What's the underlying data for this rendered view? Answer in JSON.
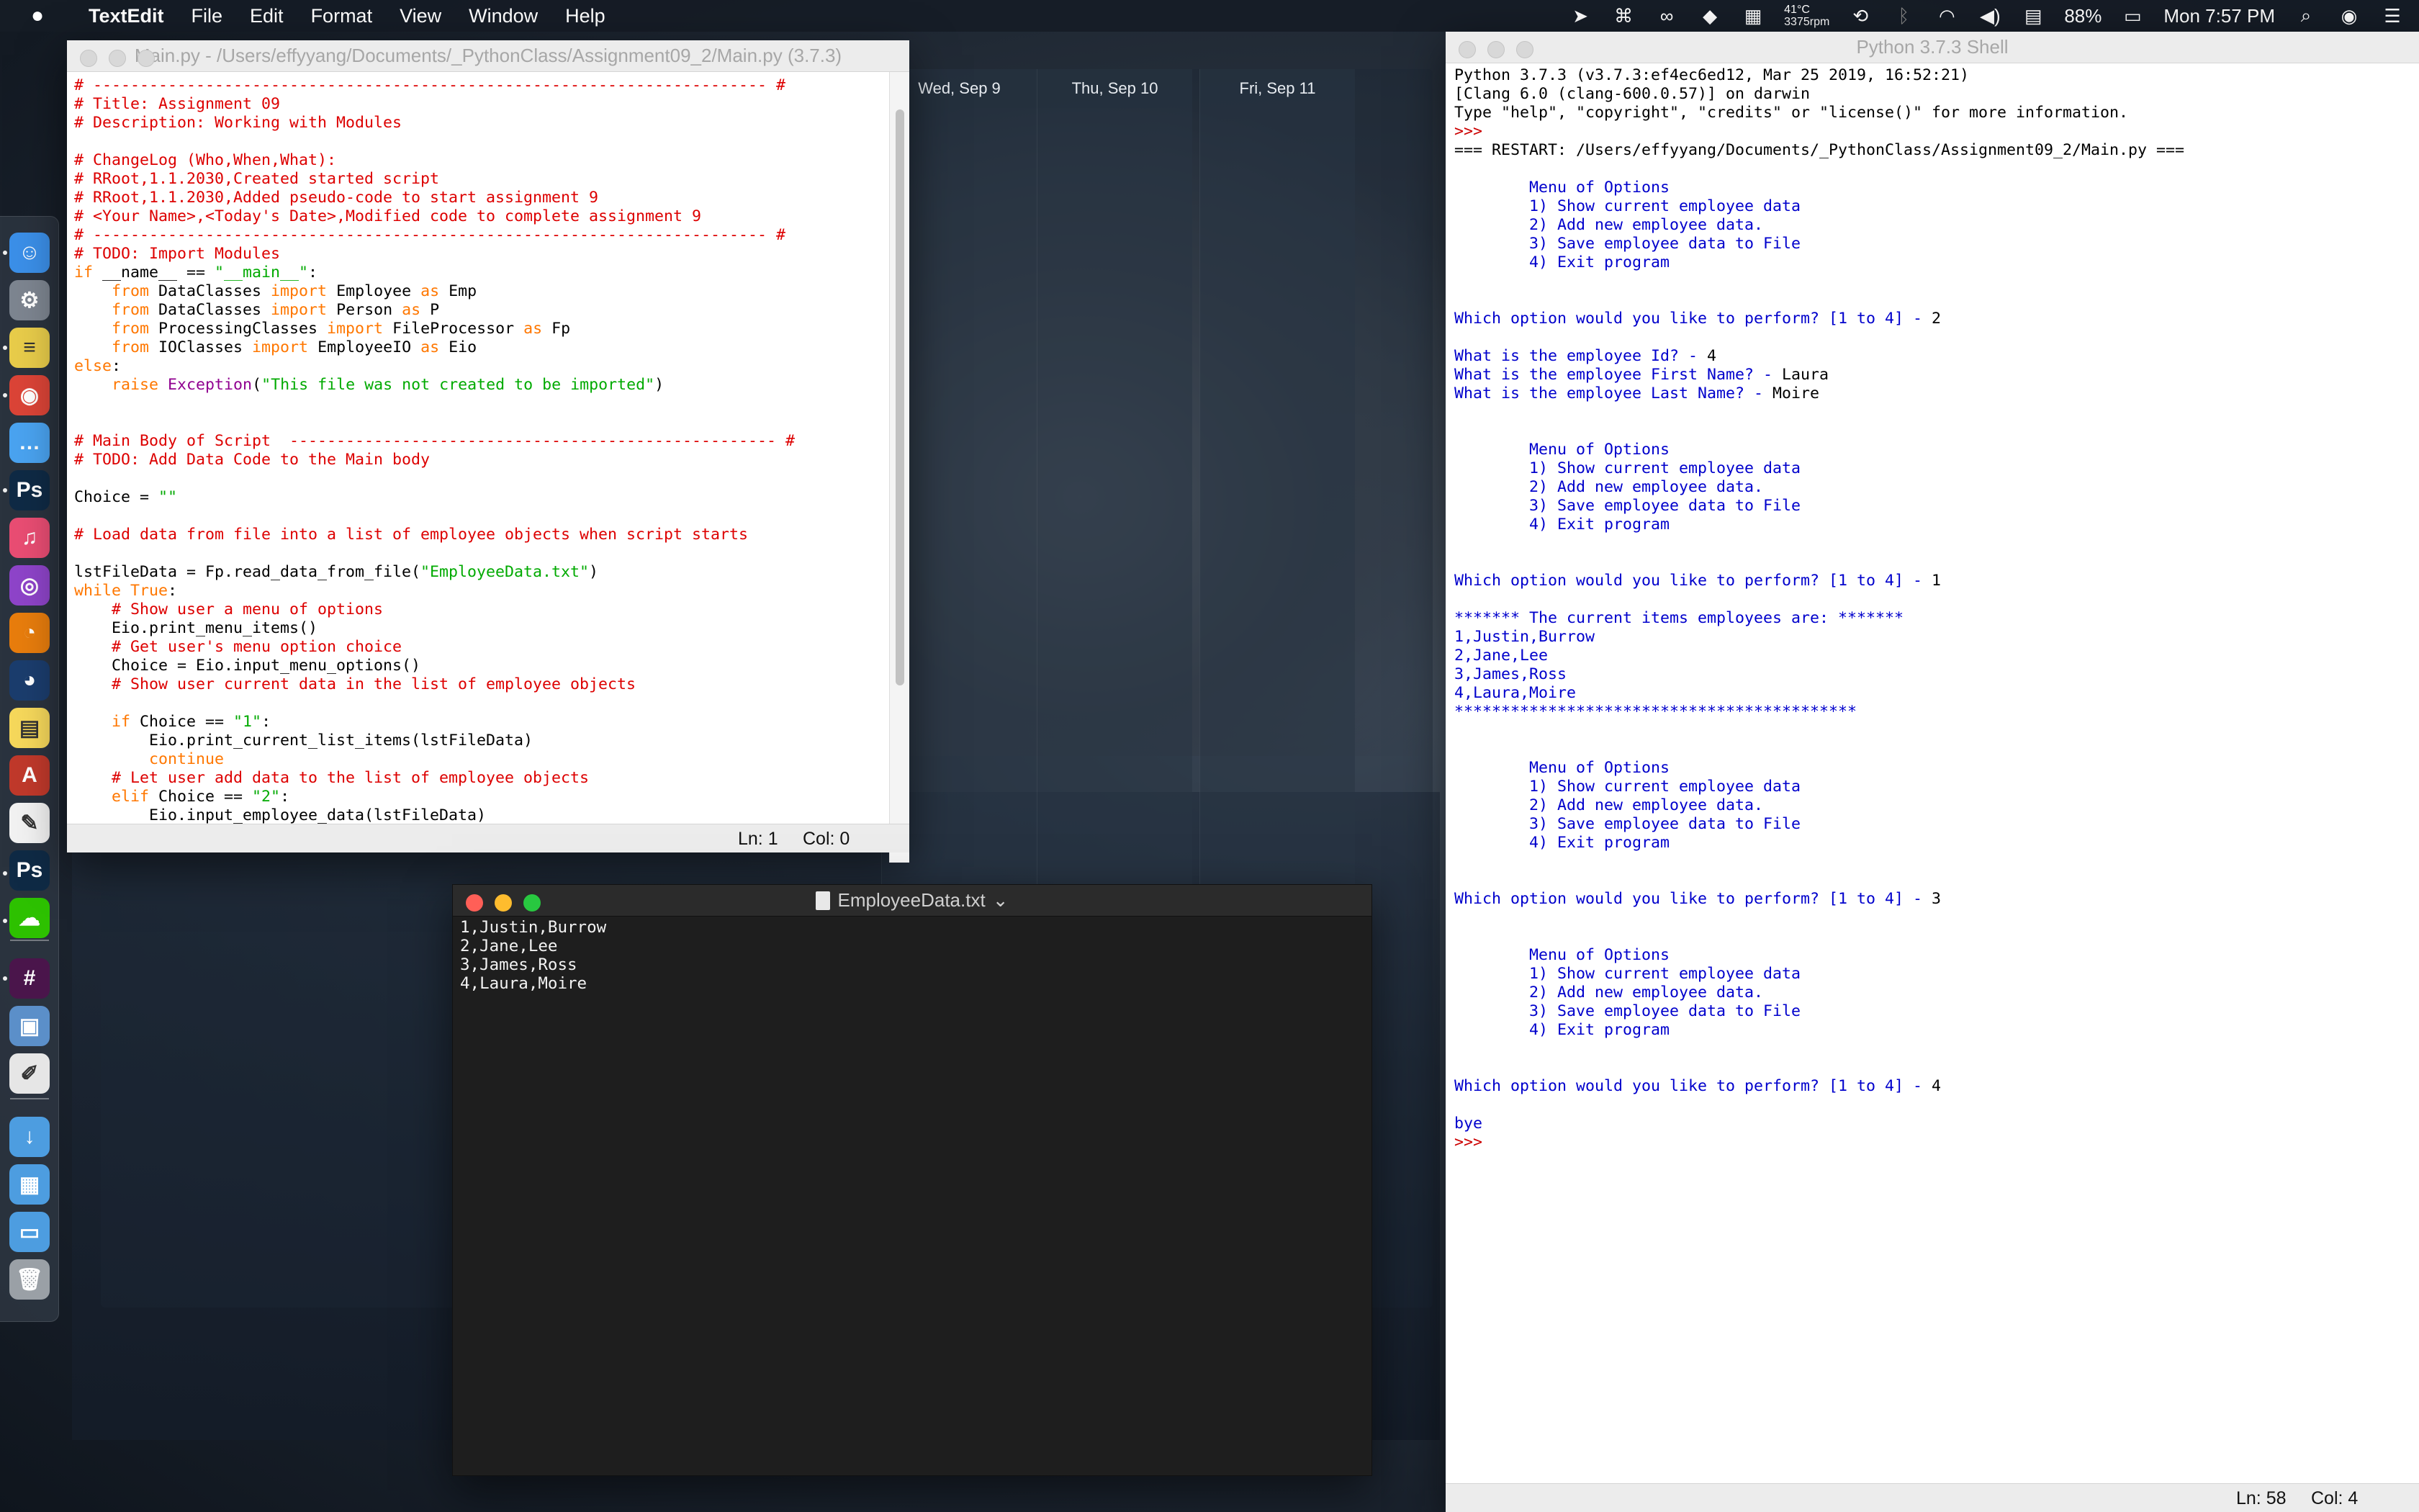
{
  "menubar": {
    "app": "TextEdit",
    "items": [
      "File",
      "Edit",
      "Format",
      "View",
      "Window",
      "Help"
    ],
    "temp_top": "41°C",
    "temp_bottom": "3375rpm",
    "battery": "88%",
    "clock": "Mon 7:57 PM"
  },
  "calendar": {
    "days": [
      "Wed, Sep 9",
      "Thu, Sep 10",
      "Fri, Sep 11"
    ]
  },
  "editor": {
    "title": "Main.py - /Users/effyyang/Documents/_PythonClass/Assignment09_2/Main.py (3.7.3)",
    "status_line": "Ln: 1",
    "status_col": "Col: 0",
    "lines": [
      [
        [
          "cm",
          "# ------------------------------------------------------------------------ #"
        ]
      ],
      [
        [
          "cm",
          "# Title: Assignment 09"
        ]
      ],
      [
        [
          "cm",
          "# Description: Working with Modules"
        ]
      ],
      [
        [
          "df",
          ""
        ]
      ],
      [
        [
          "cm",
          "# ChangeLog (Who,When,What):"
        ]
      ],
      [
        [
          "cm",
          "# RRoot,1.1.2030,Created started script"
        ]
      ],
      [
        [
          "cm",
          "# RRoot,1.1.2030,Added pseudo-code to start assignment 9"
        ]
      ],
      [
        [
          "cm",
          "# <Your Name>,<Today's Date>,Modified code to complete assignment 9"
        ]
      ],
      [
        [
          "cm",
          "# ------------------------------------------------------------------------ #"
        ]
      ],
      [
        [
          "cm",
          "# TODO: Import Modules"
        ]
      ],
      [
        [
          "kw",
          "if"
        ],
        [
          "df",
          " __name__ == "
        ],
        [
          "st",
          "\"__main__\""
        ],
        [
          "df",
          ":"
        ]
      ],
      [
        [
          "df",
          "    "
        ],
        [
          "kw",
          "from"
        ],
        [
          "df",
          " DataClasses "
        ],
        [
          "kw",
          "import"
        ],
        [
          "df",
          " Employee "
        ],
        [
          "kw",
          "as"
        ],
        [
          "df",
          " Emp"
        ]
      ],
      [
        [
          "df",
          "    "
        ],
        [
          "kw",
          "from"
        ],
        [
          "df",
          " DataClasses "
        ],
        [
          "kw",
          "import"
        ],
        [
          "df",
          " Person "
        ],
        [
          "kw",
          "as"
        ],
        [
          "df",
          " P"
        ]
      ],
      [
        [
          "df",
          "    "
        ],
        [
          "kw",
          "from"
        ],
        [
          "df",
          " ProcessingClasses "
        ],
        [
          "kw",
          "import"
        ],
        [
          "df",
          " FileProcessor "
        ],
        [
          "kw",
          "as"
        ],
        [
          "df",
          " Fp"
        ]
      ],
      [
        [
          "df",
          "    "
        ],
        [
          "kw",
          "from"
        ],
        [
          "df",
          " IOClasses "
        ],
        [
          "kw",
          "import"
        ],
        [
          "df",
          " EmployeeIO "
        ],
        [
          "kw",
          "as"
        ],
        [
          "df",
          " Eio"
        ]
      ],
      [
        [
          "kw",
          "else"
        ],
        [
          "df",
          ":"
        ]
      ],
      [
        [
          "df",
          "    "
        ],
        [
          "kw",
          "raise"
        ],
        [
          "df",
          " "
        ],
        [
          "bi",
          "Exception"
        ],
        [
          "df",
          "("
        ],
        [
          "st",
          "\"This file was not created to be imported\""
        ],
        [
          "df",
          ")"
        ]
      ],
      [
        [
          "df",
          ""
        ]
      ],
      [
        [
          "df",
          ""
        ]
      ],
      [
        [
          "cm",
          "# Main Body of Script  ---------------------------------------------------- #"
        ]
      ],
      [
        [
          "cm",
          "# TODO: Add Data Code to the Main body"
        ]
      ],
      [
        [
          "df",
          ""
        ]
      ],
      [
        [
          "df",
          "Choice = "
        ],
        [
          "st",
          "\"\""
        ]
      ],
      [
        [
          "df",
          ""
        ]
      ],
      [
        [
          "cm",
          "# Load data from file into a list of employee objects when script starts"
        ]
      ],
      [
        [
          "df",
          ""
        ]
      ],
      [
        [
          "df",
          "lstFileData = Fp.read_data_from_file("
        ],
        [
          "st",
          "\"EmployeeData.txt\""
        ],
        [
          "df",
          ")"
        ]
      ],
      [
        [
          "kw",
          "while"
        ],
        [
          "df",
          " "
        ],
        [
          "kw",
          "True"
        ],
        [
          "df",
          ":"
        ]
      ],
      [
        [
          "df",
          "    "
        ],
        [
          "cm",
          "# Show user a menu of options"
        ]
      ],
      [
        [
          "df",
          "    Eio.print_menu_items()"
        ]
      ],
      [
        [
          "df",
          "    "
        ],
        [
          "cm",
          "# Get user's menu option choice"
        ]
      ],
      [
        [
          "df",
          "    Choice = Eio.input_menu_options()"
        ]
      ],
      [
        [
          "df",
          "    "
        ],
        [
          "cm",
          "# Show user current data in the list of employee objects"
        ]
      ],
      [
        [
          "df",
          ""
        ]
      ],
      [
        [
          "df",
          "    "
        ],
        [
          "kw",
          "if"
        ],
        [
          "df",
          " Choice == "
        ],
        [
          "st",
          "\"1\""
        ],
        [
          "df",
          ":"
        ]
      ],
      [
        [
          "df",
          "        Eio.print_current_list_items(lstFileData)"
        ]
      ],
      [
        [
          "df",
          "        "
        ],
        [
          "kw",
          "continue"
        ]
      ],
      [
        [
          "df",
          "    "
        ],
        [
          "cm",
          "# Let user add data to the list of employee objects"
        ]
      ],
      [
        [
          "df",
          "    "
        ],
        [
          "kw",
          "elif"
        ],
        [
          "df",
          " Choice == "
        ],
        [
          "st",
          "\"2\""
        ],
        [
          "df",
          ":"
        ]
      ],
      [
        [
          "df",
          "        Eio.input_employee_data(lstFileData)"
        ]
      ]
    ]
  },
  "textfile": {
    "title": "EmployeeData.txt",
    "lines": [
      "1,Justin,Burrow",
      "2,Jane,Lee",
      "3,James,Ross",
      "4,Laura,Moire"
    ]
  },
  "shell": {
    "title": "Python 3.7.3 Shell",
    "status_line": "Ln: 58",
    "status_col": "Col: 4",
    "lines": [
      [
        [
          "df",
          "Python 3.7.3 (v3.7.3:ef4ec6ed12, Mar 25 2019, 16:52:21)"
        ]
      ],
      [
        [
          "df",
          "[Clang 6.0 (clang-600.0.57)] on darwin"
        ]
      ],
      [
        [
          "df",
          "Type \"help\", \"copyright\", \"credits\" or \"license()\" for more information."
        ]
      ],
      [
        [
          "rd",
          ">>> "
        ]
      ],
      [
        [
          "df",
          "=== RESTART: /Users/effyyang/Documents/_PythonClass/Assignment09_2/Main.py ==="
        ]
      ],
      [
        [
          "df",
          ""
        ]
      ],
      [
        [
          "bl",
          "        Menu of Options"
        ]
      ],
      [
        [
          "bl",
          "        1) Show current employee data"
        ]
      ],
      [
        [
          "bl",
          "        2) Add new employee data."
        ]
      ],
      [
        [
          "bl",
          "        3) Save employee data to File"
        ]
      ],
      [
        [
          "bl",
          "        4) Exit program"
        ]
      ],
      [
        [
          "df",
          ""
        ]
      ],
      [
        [
          "df",
          ""
        ]
      ],
      [
        [
          "bl",
          "Which option would you like to perform? [1 to 4] - "
        ],
        [
          "df",
          "2"
        ]
      ],
      [
        [
          "df",
          ""
        ]
      ],
      [
        [
          "bl",
          "What is the employee Id? - "
        ],
        [
          "df",
          "4"
        ]
      ],
      [
        [
          "bl",
          "What is the employee First Name? - "
        ],
        [
          "df",
          "Laura"
        ]
      ],
      [
        [
          "bl",
          "What is the employee Last Name? - "
        ],
        [
          "df",
          "Moire"
        ]
      ],
      [
        [
          "df",
          ""
        ]
      ],
      [
        [
          "df",
          ""
        ]
      ],
      [
        [
          "bl",
          "        Menu of Options"
        ]
      ],
      [
        [
          "bl",
          "        1) Show current employee data"
        ]
      ],
      [
        [
          "bl",
          "        2) Add new employee data."
        ]
      ],
      [
        [
          "bl",
          "        3) Save employee data to File"
        ]
      ],
      [
        [
          "bl",
          "        4) Exit program"
        ]
      ],
      [
        [
          "df",
          ""
        ]
      ],
      [
        [
          "df",
          ""
        ]
      ],
      [
        [
          "bl",
          "Which option would you like to perform? [1 to 4] - "
        ],
        [
          "df",
          "1"
        ]
      ],
      [
        [
          "df",
          ""
        ]
      ],
      [
        [
          "bl",
          "******* The current items employees are: *******"
        ]
      ],
      [
        [
          "bl",
          "1,Justin,Burrow"
        ]
      ],
      [
        [
          "bl",
          "2,Jane,Lee"
        ]
      ],
      [
        [
          "bl",
          "3,James,Ross"
        ]
      ],
      [
        [
          "bl",
          "4,Laura,Moire"
        ]
      ],
      [
        [
          "bl",
          "*******************************************"
        ]
      ],
      [
        [
          "df",
          ""
        ]
      ],
      [
        [
          "df",
          ""
        ]
      ],
      [
        [
          "bl",
          "        Menu of Options"
        ]
      ],
      [
        [
          "bl",
          "        1) Show current employee data"
        ]
      ],
      [
        [
          "bl",
          "        2) Add new employee data."
        ]
      ],
      [
        [
          "bl",
          "        3) Save employee data to File"
        ]
      ],
      [
        [
          "bl",
          "        4) Exit program"
        ]
      ],
      [
        [
          "df",
          ""
        ]
      ],
      [
        [
          "df",
          ""
        ]
      ],
      [
        [
          "bl",
          "Which option would you like to perform? [1 to 4] - "
        ],
        [
          "df",
          "3"
        ]
      ],
      [
        [
          "df",
          ""
        ]
      ],
      [
        [
          "df",
          ""
        ]
      ],
      [
        [
          "bl",
          "        Menu of Options"
        ]
      ],
      [
        [
          "bl",
          "        1) Show current employee data"
        ]
      ],
      [
        [
          "bl",
          "        2) Add new employee data."
        ]
      ],
      [
        [
          "bl",
          "        3) Save employee data to File"
        ]
      ],
      [
        [
          "bl",
          "        4) Exit program"
        ]
      ],
      [
        [
          "df",
          ""
        ]
      ],
      [
        [
          "df",
          ""
        ]
      ],
      [
        [
          "bl",
          "Which option would you like to perform? [1 to 4] - "
        ],
        [
          "df",
          "4"
        ]
      ],
      [
        [
          "df",
          ""
        ]
      ],
      [
        [
          "bl",
          "bye"
        ]
      ],
      [
        [
          "rd",
          ">>> "
        ]
      ]
    ]
  },
  "dock": {
    "icons": [
      {
        "name": "finder-icon",
        "glyph": "☺",
        "color": "#3b8fe8"
      },
      {
        "name": "system-preferences-icon",
        "glyph": "⚙",
        "color": "#7d8590"
      },
      {
        "name": "stickies-icon",
        "glyph": "≡",
        "color": "#e8cc4a"
      },
      {
        "name": "chrome-icon",
        "glyph": "◉",
        "color": "#db4437"
      },
      {
        "name": "messages-icon",
        "glyph": "…",
        "color": "#4aa3f0"
      },
      {
        "name": "photoshop-icon",
        "glyph": "Ps",
        "color": "#0f2a45"
      },
      {
        "name": "music-icon",
        "glyph": "♫",
        "color": "#e94d73"
      },
      {
        "name": "podcasts-icon",
        "glyph": "◎",
        "color": "#8e44c9"
      },
      {
        "name": "blender-icon",
        "glyph": "◔",
        "color": "#e87d0d"
      },
      {
        "name": "cinema4d-icon",
        "glyph": "◕",
        "color": "#1b3d6d"
      },
      {
        "name": "notes-icon",
        "glyph": "▤",
        "color": "#f6d85b"
      },
      {
        "name": "font-book-icon",
        "glyph": "A",
        "color": "#c0392b"
      },
      {
        "name": "textedit-icon",
        "glyph": "✎",
        "color": "#f2f2f2"
      },
      {
        "name": "photoshop-2-icon",
        "glyph": "Ps",
        "color": "#0f2a45"
      },
      {
        "name": "wechat-icon",
        "glyph": "☁",
        "color": "#2dc100"
      },
      {
        "name": "slack-icon",
        "glyph": "#",
        "color": "#4a154b"
      },
      {
        "name": "preview-icon",
        "glyph": "▣",
        "color": "#5b8fc9"
      },
      {
        "name": "script-editor-icon",
        "glyph": "✐",
        "color": "#e6e6e6"
      },
      {
        "name": "downloads-folder-icon",
        "glyph": "↓",
        "color": "#4d9de0"
      },
      {
        "name": "applications-folder-icon",
        "glyph": "▦",
        "color": "#4d9de0"
      },
      {
        "name": "documents-folder-icon",
        "glyph": "▭",
        "color": "#4d9de0"
      },
      {
        "name": "trash-icon",
        "glyph": "🗑",
        "color": "#9aa0a6"
      }
    ]
  }
}
